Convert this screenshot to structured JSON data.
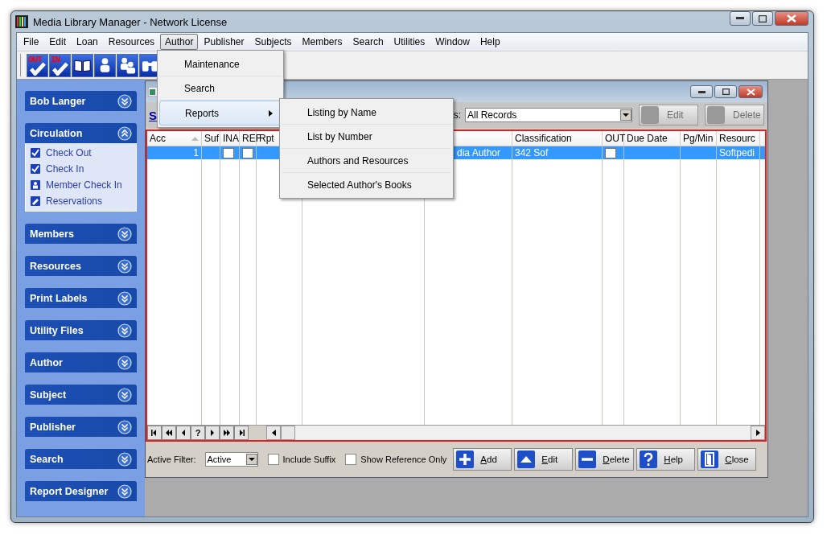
{
  "window": {
    "title": "Media Library Manager - Network License",
    "menu": [
      {
        "label": "File",
        "selected": false
      },
      {
        "label": "Edit",
        "selected": false
      },
      {
        "label": "Loan",
        "selected": false
      },
      {
        "label": "Resources",
        "selected": false
      },
      {
        "label": "Author",
        "selected": true
      },
      {
        "label": "Publisher",
        "selected": false
      },
      {
        "label": "Subjects",
        "selected": false
      },
      {
        "label": "Members",
        "selected": false
      },
      {
        "label": "Search",
        "selected": false
      },
      {
        "label": "Utilities",
        "selected": false
      },
      {
        "label": "Window",
        "selected": false
      },
      {
        "label": "Help",
        "selected": false
      }
    ],
    "toolbar": [
      {
        "kind": "check",
        "label": "OUT"
      },
      {
        "kind": "check",
        "label": "IN"
      },
      {
        "kind": "book"
      },
      {
        "kind": "member"
      },
      {
        "kind": "members"
      },
      {
        "kind": "binoculars"
      }
    ]
  },
  "sidebar": {
    "groups": [
      {
        "title": "Bob Langer",
        "expanded": false
      },
      {
        "title": "Circulation",
        "expanded": true,
        "items": [
          {
            "label": "Check Out",
            "kind": "check-out"
          },
          {
            "label": "Check In",
            "kind": "check-in"
          },
          {
            "label": "Member Check In",
            "kind": "member"
          },
          {
            "label": "Reservations",
            "kind": "reservation"
          }
        ]
      },
      {
        "title": "Members",
        "expanded": false
      },
      {
        "title": "Resources",
        "expanded": false
      },
      {
        "title": "Print Labels",
        "expanded": false
      },
      {
        "title": "Utility Files",
        "expanded": false
      },
      {
        "title": "Author",
        "expanded": false
      },
      {
        "title": "Subject",
        "expanded": false
      },
      {
        "title": "Publisher",
        "expanded": false
      },
      {
        "title": "Search",
        "expanded": false
      },
      {
        "title": "Report Designer",
        "expanded": false
      }
    ]
  },
  "author_menu": {
    "items": [
      {
        "label": "Maintenance",
        "selected": false,
        "submenu": false
      },
      {
        "label": "Search",
        "selected": false,
        "submenu": false
      },
      {
        "label": "Reports",
        "selected": true,
        "submenu": true
      }
    ]
  },
  "reports_submenu": {
    "items": [
      {
        "label": "Listing by Name"
      },
      {
        "label": "List by Number"
      },
      {
        "label": "Authors and Resources"
      },
      {
        "label": "Selected Author's Books"
      }
    ]
  },
  "child_window": {
    "link": "S",
    "filter_label": "s:",
    "filter_value": "All Records",
    "buttons": [
      {
        "label": "Edit",
        "disabled": true
      },
      {
        "label": "Delete",
        "disabled": true
      }
    ],
    "table": {
      "columns": [
        "Acc",
        "Suf",
        "INA",
        "REF",
        "Rpt",
        null,
        null,
        "Classification",
        "OUT",
        "Due Date",
        "Pg/Min",
        "Resourc"
      ],
      "rows": [
        {
          "selected": true,
          "cells": [
            {
              "kind": "text",
              "text": "1"
            },
            {
              "kind": "empty"
            },
            {
              "kind": "checkbox",
              "checked": false
            },
            {
              "kind": "checkbox",
              "checked": false
            },
            {
              "kind": "empty"
            },
            {
              "kind": "empty"
            },
            {
              "kind": "text",
              "text": "dia Author"
            },
            {
              "kind": "text",
              "text": "342 Sof"
            },
            {
              "kind": "checkbox",
              "checked": false
            },
            {
              "kind": "empty"
            },
            {
              "kind": "empty"
            },
            {
              "kind": "text",
              "text": "Softpedi"
            }
          ]
        }
      ]
    },
    "navigator": [
      {
        "kind": "first"
      },
      {
        "kind": "prev-page"
      },
      {
        "kind": "prev"
      },
      {
        "kind": "text",
        "label": "?"
      },
      {
        "kind": "next"
      },
      {
        "kind": "next-page"
      },
      {
        "kind": "last"
      }
    ],
    "active_filter": {
      "label": "Active Filter:",
      "value": "Active"
    },
    "options": [
      {
        "label": "Include Suffix",
        "checked": false
      },
      {
        "label": "Show Reference Only",
        "checked": false
      }
    ],
    "actions": [
      {
        "kind": "add",
        "label": "Add"
      },
      {
        "kind": "edit",
        "label": "Edit"
      },
      {
        "kind": "delete",
        "label": "Delete"
      },
      {
        "kind": "help",
        "label": "Help"
      },
      {
        "kind": "close",
        "label": "Close"
      }
    ]
  }
}
